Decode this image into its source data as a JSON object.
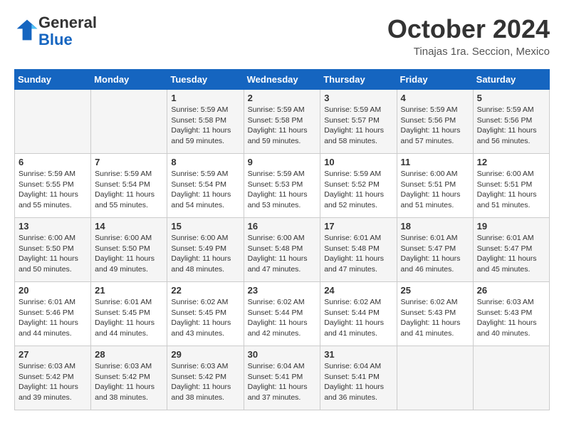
{
  "header": {
    "logo_line1": "General",
    "logo_line2": "Blue",
    "month": "October 2024",
    "location": "Tinajas 1ra. Seccion, Mexico"
  },
  "days_of_week": [
    "Sunday",
    "Monday",
    "Tuesday",
    "Wednesday",
    "Thursday",
    "Friday",
    "Saturday"
  ],
  "weeks": [
    [
      {
        "day": "",
        "sunrise": "",
        "sunset": "",
        "daylight": ""
      },
      {
        "day": "",
        "sunrise": "",
        "sunset": "",
        "daylight": ""
      },
      {
        "day": "1",
        "sunrise": "Sunrise: 5:59 AM",
        "sunset": "Sunset: 5:58 PM",
        "daylight": "Daylight: 11 hours and 59 minutes."
      },
      {
        "day": "2",
        "sunrise": "Sunrise: 5:59 AM",
        "sunset": "Sunset: 5:58 PM",
        "daylight": "Daylight: 11 hours and 59 minutes."
      },
      {
        "day": "3",
        "sunrise": "Sunrise: 5:59 AM",
        "sunset": "Sunset: 5:57 PM",
        "daylight": "Daylight: 11 hours and 58 minutes."
      },
      {
        "day": "4",
        "sunrise": "Sunrise: 5:59 AM",
        "sunset": "Sunset: 5:56 PM",
        "daylight": "Daylight: 11 hours and 57 minutes."
      },
      {
        "day": "5",
        "sunrise": "Sunrise: 5:59 AM",
        "sunset": "Sunset: 5:56 PM",
        "daylight": "Daylight: 11 hours and 56 minutes."
      }
    ],
    [
      {
        "day": "6",
        "sunrise": "Sunrise: 5:59 AM",
        "sunset": "Sunset: 5:55 PM",
        "daylight": "Daylight: 11 hours and 55 minutes."
      },
      {
        "day": "7",
        "sunrise": "Sunrise: 5:59 AM",
        "sunset": "Sunset: 5:54 PM",
        "daylight": "Daylight: 11 hours and 55 minutes."
      },
      {
        "day": "8",
        "sunrise": "Sunrise: 5:59 AM",
        "sunset": "Sunset: 5:54 PM",
        "daylight": "Daylight: 11 hours and 54 minutes."
      },
      {
        "day": "9",
        "sunrise": "Sunrise: 5:59 AM",
        "sunset": "Sunset: 5:53 PM",
        "daylight": "Daylight: 11 hours and 53 minutes."
      },
      {
        "day": "10",
        "sunrise": "Sunrise: 5:59 AM",
        "sunset": "Sunset: 5:52 PM",
        "daylight": "Daylight: 11 hours and 52 minutes."
      },
      {
        "day": "11",
        "sunrise": "Sunrise: 6:00 AM",
        "sunset": "Sunset: 5:51 PM",
        "daylight": "Daylight: 11 hours and 51 minutes."
      },
      {
        "day": "12",
        "sunrise": "Sunrise: 6:00 AM",
        "sunset": "Sunset: 5:51 PM",
        "daylight": "Daylight: 11 hours and 51 minutes."
      }
    ],
    [
      {
        "day": "13",
        "sunrise": "Sunrise: 6:00 AM",
        "sunset": "Sunset: 5:50 PM",
        "daylight": "Daylight: 11 hours and 50 minutes."
      },
      {
        "day": "14",
        "sunrise": "Sunrise: 6:00 AM",
        "sunset": "Sunset: 5:50 PM",
        "daylight": "Daylight: 11 hours and 49 minutes."
      },
      {
        "day": "15",
        "sunrise": "Sunrise: 6:00 AM",
        "sunset": "Sunset: 5:49 PM",
        "daylight": "Daylight: 11 hours and 48 minutes."
      },
      {
        "day": "16",
        "sunrise": "Sunrise: 6:00 AM",
        "sunset": "Sunset: 5:48 PM",
        "daylight": "Daylight: 11 hours and 47 minutes."
      },
      {
        "day": "17",
        "sunrise": "Sunrise: 6:01 AM",
        "sunset": "Sunset: 5:48 PM",
        "daylight": "Daylight: 11 hours and 47 minutes."
      },
      {
        "day": "18",
        "sunrise": "Sunrise: 6:01 AM",
        "sunset": "Sunset: 5:47 PM",
        "daylight": "Daylight: 11 hours and 46 minutes."
      },
      {
        "day": "19",
        "sunrise": "Sunrise: 6:01 AM",
        "sunset": "Sunset: 5:47 PM",
        "daylight": "Daylight: 11 hours and 45 minutes."
      }
    ],
    [
      {
        "day": "20",
        "sunrise": "Sunrise: 6:01 AM",
        "sunset": "Sunset: 5:46 PM",
        "daylight": "Daylight: 11 hours and 44 minutes."
      },
      {
        "day": "21",
        "sunrise": "Sunrise: 6:01 AM",
        "sunset": "Sunset: 5:45 PM",
        "daylight": "Daylight: 11 hours and 44 minutes."
      },
      {
        "day": "22",
        "sunrise": "Sunrise: 6:02 AM",
        "sunset": "Sunset: 5:45 PM",
        "daylight": "Daylight: 11 hours and 43 minutes."
      },
      {
        "day": "23",
        "sunrise": "Sunrise: 6:02 AM",
        "sunset": "Sunset: 5:44 PM",
        "daylight": "Daylight: 11 hours and 42 minutes."
      },
      {
        "day": "24",
        "sunrise": "Sunrise: 6:02 AM",
        "sunset": "Sunset: 5:44 PM",
        "daylight": "Daylight: 11 hours and 41 minutes."
      },
      {
        "day": "25",
        "sunrise": "Sunrise: 6:02 AM",
        "sunset": "Sunset: 5:43 PM",
        "daylight": "Daylight: 11 hours and 41 minutes."
      },
      {
        "day": "26",
        "sunrise": "Sunrise: 6:03 AM",
        "sunset": "Sunset: 5:43 PM",
        "daylight": "Daylight: 11 hours and 40 minutes."
      }
    ],
    [
      {
        "day": "27",
        "sunrise": "Sunrise: 6:03 AM",
        "sunset": "Sunset: 5:42 PM",
        "daylight": "Daylight: 11 hours and 39 minutes."
      },
      {
        "day": "28",
        "sunrise": "Sunrise: 6:03 AM",
        "sunset": "Sunset: 5:42 PM",
        "daylight": "Daylight: 11 hours and 38 minutes."
      },
      {
        "day": "29",
        "sunrise": "Sunrise: 6:03 AM",
        "sunset": "Sunset: 5:42 PM",
        "daylight": "Daylight: 11 hours and 38 minutes."
      },
      {
        "day": "30",
        "sunrise": "Sunrise: 6:04 AM",
        "sunset": "Sunset: 5:41 PM",
        "daylight": "Daylight: 11 hours and 37 minutes."
      },
      {
        "day": "31",
        "sunrise": "Sunrise: 6:04 AM",
        "sunset": "Sunset: 5:41 PM",
        "daylight": "Daylight: 11 hours and 36 minutes."
      },
      {
        "day": "",
        "sunrise": "",
        "sunset": "",
        "daylight": ""
      },
      {
        "day": "",
        "sunrise": "",
        "sunset": "",
        "daylight": ""
      }
    ]
  ]
}
